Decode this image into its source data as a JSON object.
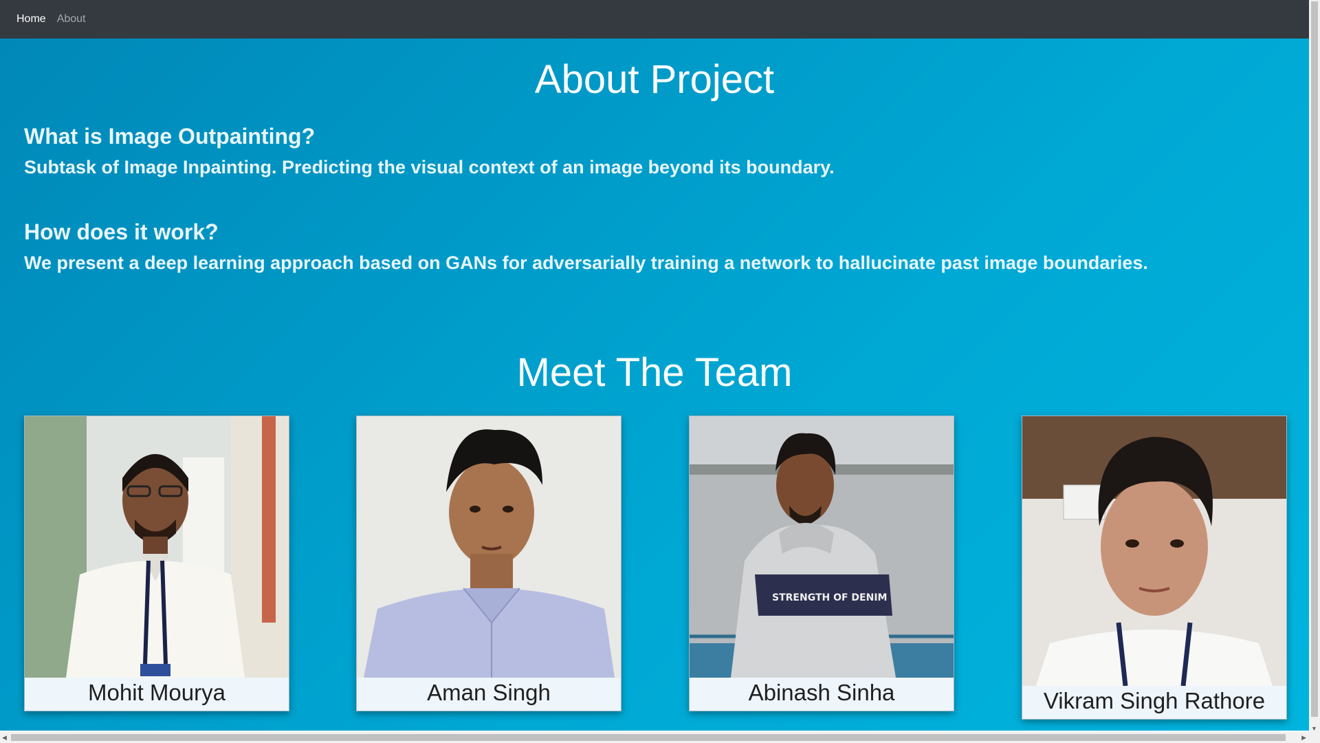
{
  "nav": {
    "home_label": "Home",
    "about_label": "About"
  },
  "page": {
    "title": "About Project",
    "q1": "What is Image Outpainting?",
    "a1": "Subtask of Image Inpainting. Predicting the visual context of an image beyond its boundary.",
    "q2": "How does it work?",
    "a2": "We present a deep learning approach based on GANs for adversarially training a network to hallucinate past image boundaries.",
    "team_title": "Meet The Team"
  },
  "team": [
    {
      "name": "Mohit Mourya"
    },
    {
      "name": "Aman Singh"
    },
    {
      "name": "Abinash Sinha"
    },
    {
      "name": "Vikram Singh Rathore"
    }
  ],
  "colors": {
    "navbar": "#343a40",
    "background": "#00a8d4",
    "card": "#eef5fb"
  }
}
